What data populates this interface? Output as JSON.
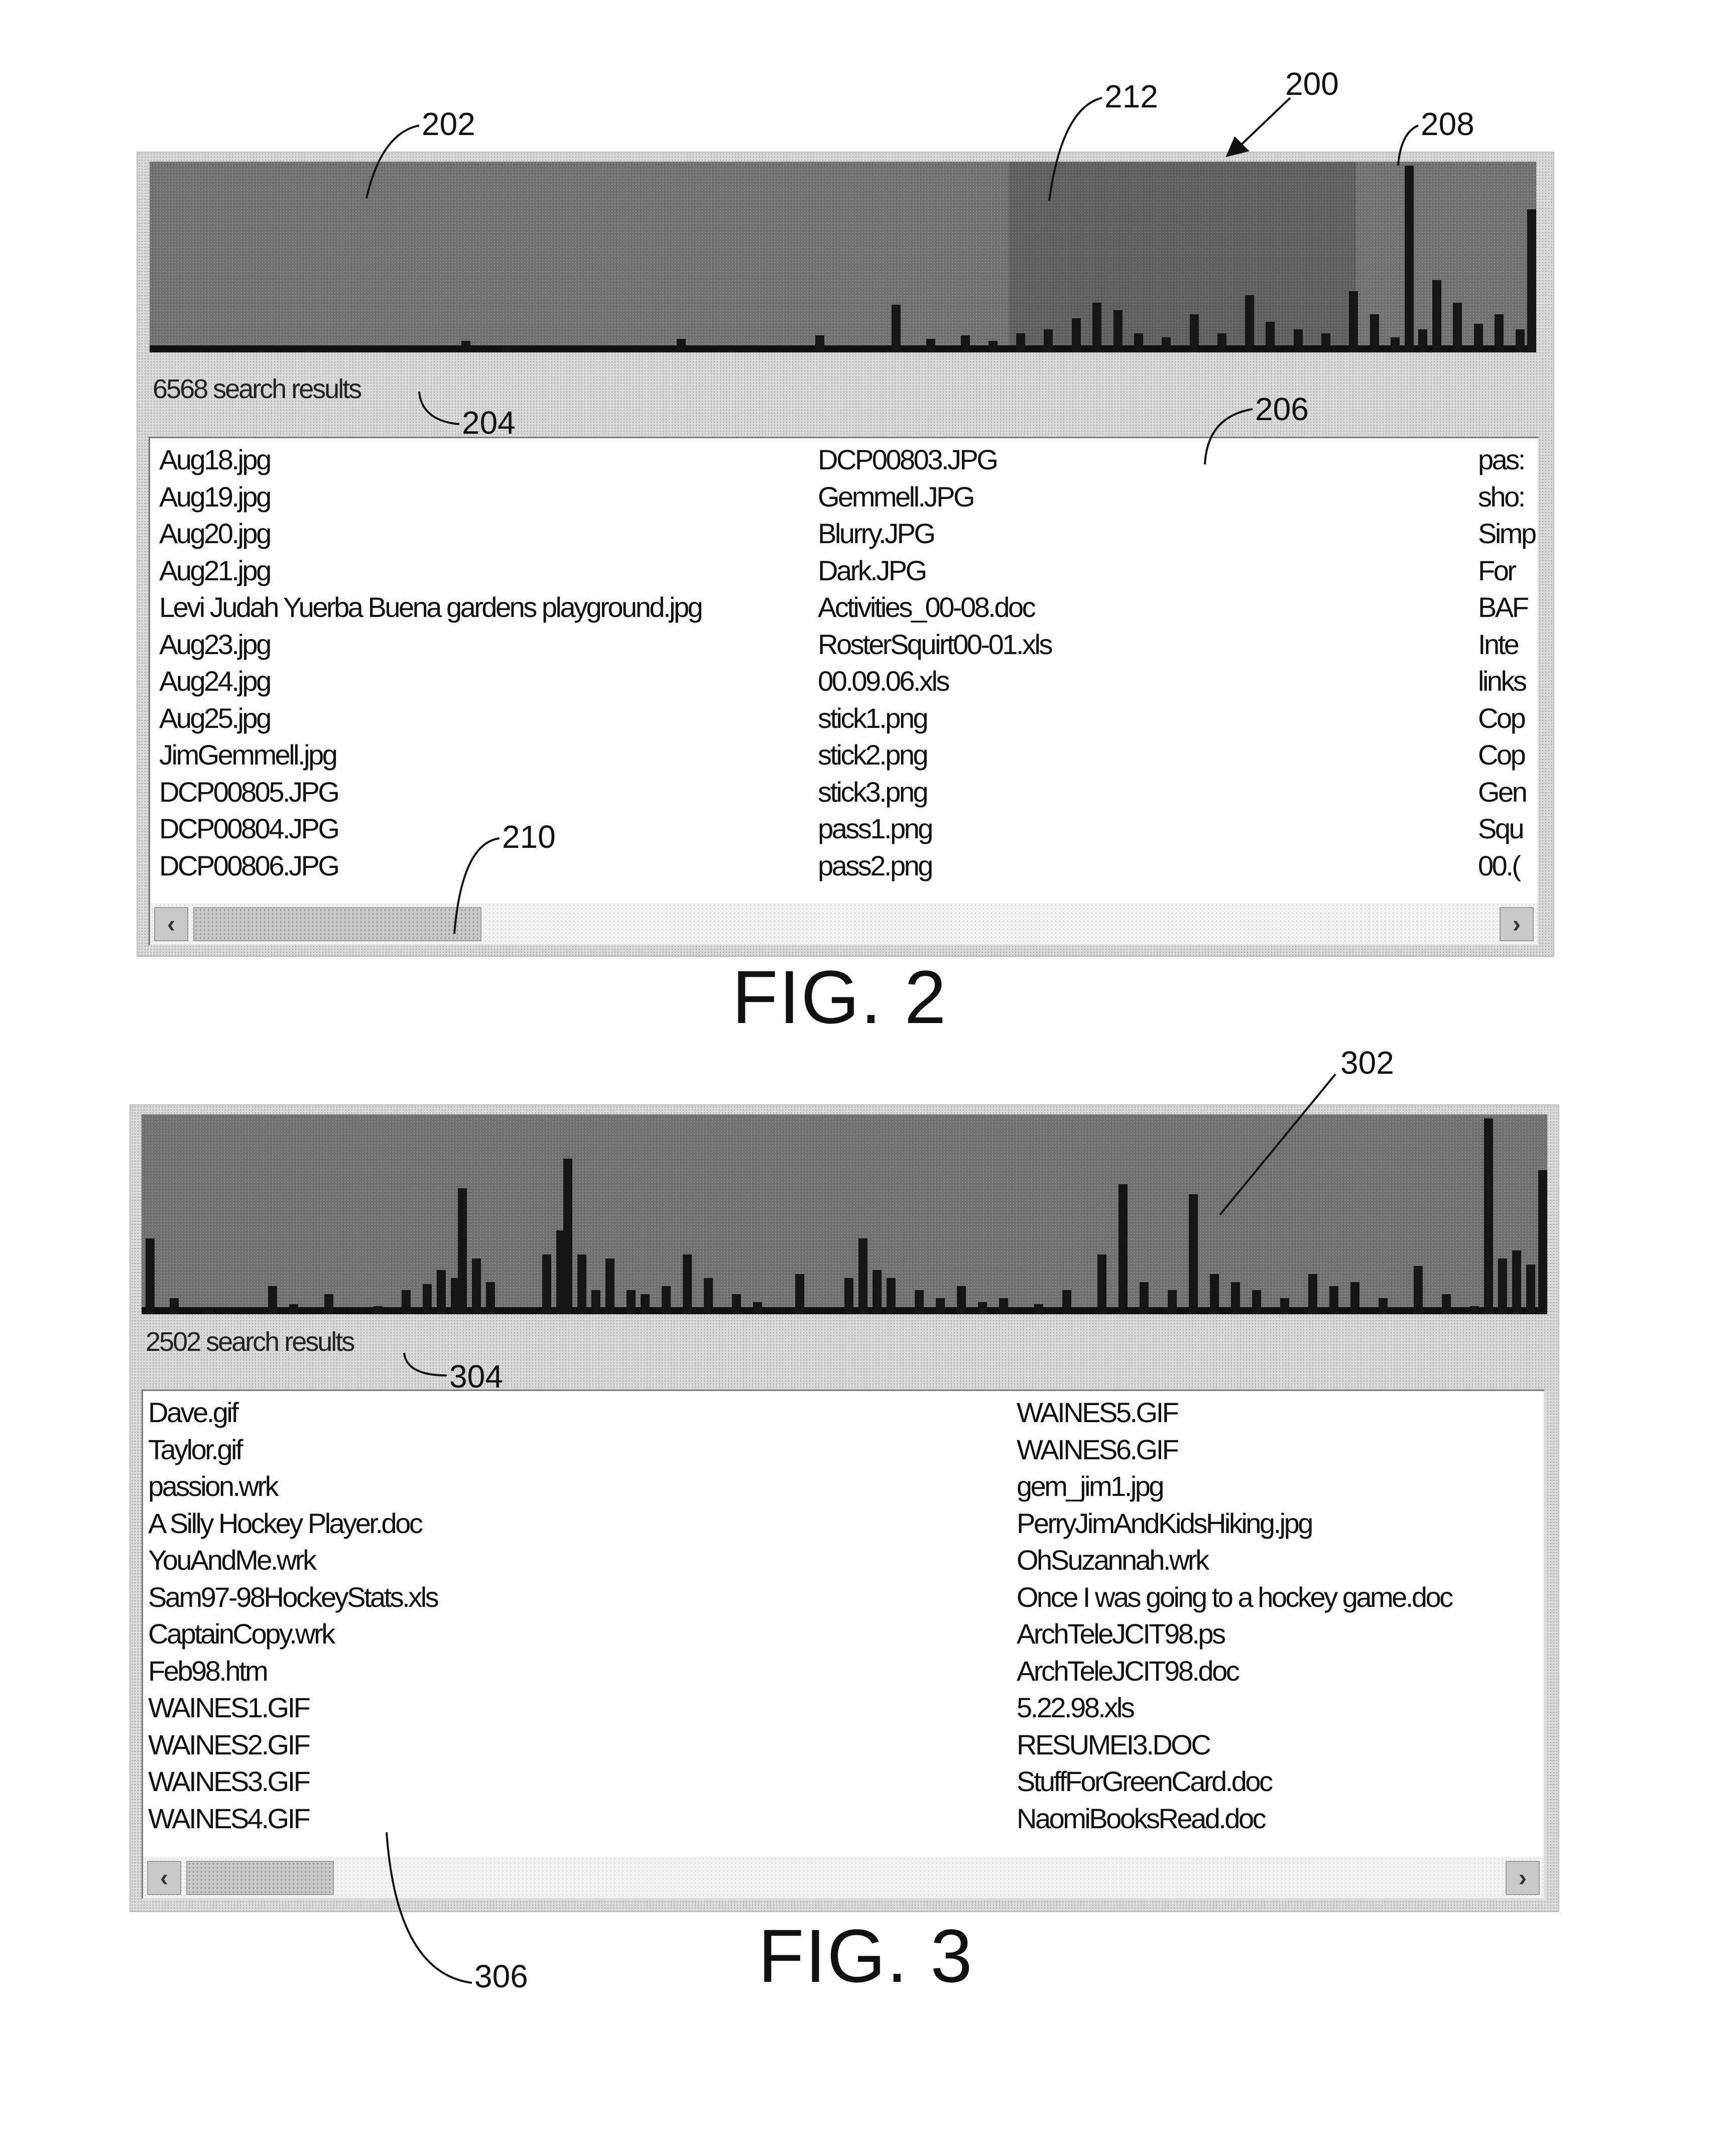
{
  "figures": [
    {
      "label": "FIG. 2",
      "result_count_text": "6568 search results",
      "reference_numerals": {
        "ui": "200",
        "histogram": "202",
        "result_count": "204",
        "result_list": "206",
        "histogram_spike": "208",
        "scrollbar": "210",
        "selected_range": "212"
      },
      "histogram": {
        "selected_range_fraction": [
          0.62,
          0.87
        ],
        "bars": [
          {
            "pos": 0.225,
            "h": 0.06
          },
          {
            "pos": 0.255,
            "h": 0.03
          },
          {
            "pos": 0.38,
            "h": 0.07
          },
          {
            "pos": 0.48,
            "h": 0.09
          },
          {
            "pos": 0.535,
            "h": 0.25
          },
          {
            "pos": 0.56,
            "h": 0.07
          },
          {
            "pos": 0.585,
            "h": 0.09
          },
          {
            "pos": 0.605,
            "h": 0.06
          },
          {
            "pos": 0.625,
            "h": 0.1
          },
          {
            "pos": 0.645,
            "h": 0.12
          },
          {
            "pos": 0.665,
            "h": 0.18
          },
          {
            "pos": 0.68,
            "h": 0.26
          },
          {
            "pos": 0.695,
            "h": 0.22
          },
          {
            "pos": 0.71,
            "h": 0.1
          },
          {
            "pos": 0.73,
            "h": 0.08
          },
          {
            "pos": 0.75,
            "h": 0.2
          },
          {
            "pos": 0.77,
            "h": 0.1
          },
          {
            "pos": 0.79,
            "h": 0.3
          },
          {
            "pos": 0.805,
            "h": 0.16
          },
          {
            "pos": 0.825,
            "h": 0.12
          },
          {
            "pos": 0.845,
            "h": 0.1
          },
          {
            "pos": 0.865,
            "h": 0.32
          },
          {
            "pos": 0.88,
            "h": 0.2
          },
          {
            "pos": 0.895,
            "h": 0.08
          },
          {
            "pos": 0.905,
            "h": 0.98
          },
          {
            "pos": 0.915,
            "h": 0.12
          },
          {
            "pos": 0.925,
            "h": 0.38
          },
          {
            "pos": 0.94,
            "h": 0.26
          },
          {
            "pos": 0.955,
            "h": 0.15
          },
          {
            "pos": 0.97,
            "h": 0.2
          },
          {
            "pos": 0.985,
            "h": 0.12
          },
          {
            "pos": 0.995,
            "h": 0.75
          }
        ]
      },
      "columns": [
        [
          "Aug18.jpg",
          "Aug19.jpg",
          "Aug20.jpg",
          "Aug21.jpg",
          "Levi Judah Yuerba Buena gardens playground.jpg",
          "Aug23.jpg",
          "Aug24.jpg",
          "Aug25.jpg",
          "JimGemmell.jpg",
          "DCP00805.JPG",
          "DCP00804.JPG",
          "DCP00806.JPG"
        ],
        [
          "DCP00803.JPG",
          "Gemmell.JPG",
          "Blurry.JPG",
          "Dark.JPG",
          "Activities_00-08.doc",
          "RosterSquirt00-01.xls",
          "00.09.06.xls",
          "stick1.png",
          "stick2.png",
          "stick3.png",
          "pass1.png",
          "pass2.png"
        ],
        [
          "pas:",
          "sho:",
          "Simp",
          "For",
          "BAF",
          "Inte",
          "links",
          "Cop",
          "Cop",
          "Gen",
          "Squ",
          "00.("
        ]
      ],
      "scrollbar": {
        "left_arrow": "‹",
        "right_arrow": "›",
        "thumb_fraction": 0.2
      }
    },
    {
      "label": "FIG. 3",
      "result_count_text": "2502 search results",
      "reference_numerals": {
        "histogram": "302",
        "result_count": "304",
        "result_list": "306"
      },
      "histogram": {
        "bars": [
          {
            "pos": 0.003,
            "h": 0.38
          },
          {
            "pos": 0.02,
            "h": 0.08
          },
          {
            "pos": 0.045,
            "h": 0.02
          },
          {
            "pos": 0.09,
            "h": 0.14
          },
          {
            "pos": 0.105,
            "h": 0.05
          },
          {
            "pos": 0.13,
            "h": 0.1
          },
          {
            "pos": 0.165,
            "h": 0.04
          },
          {
            "pos": 0.185,
            "h": 0.12
          },
          {
            "pos": 0.2,
            "h": 0.15
          },
          {
            "pos": 0.21,
            "h": 0.22
          },
          {
            "pos": 0.22,
            "h": 0.18
          },
          {
            "pos": 0.225,
            "h": 0.63
          },
          {
            "pos": 0.235,
            "h": 0.28
          },
          {
            "pos": 0.245,
            "h": 0.16
          },
          {
            "pos": 0.285,
            "h": 0.3
          },
          {
            "pos": 0.295,
            "h": 0.42
          },
          {
            "pos": 0.3,
            "h": 0.78
          },
          {
            "pos": 0.31,
            "h": 0.3
          },
          {
            "pos": 0.32,
            "h": 0.12
          },
          {
            "pos": 0.33,
            "h": 0.28
          },
          {
            "pos": 0.345,
            "h": 0.12
          },
          {
            "pos": 0.355,
            "h": 0.1
          },
          {
            "pos": 0.37,
            "h": 0.14
          },
          {
            "pos": 0.385,
            "h": 0.3
          },
          {
            "pos": 0.4,
            "h": 0.18
          },
          {
            "pos": 0.42,
            "h": 0.1
          },
          {
            "pos": 0.435,
            "h": 0.06
          },
          {
            "pos": 0.465,
            "h": 0.2
          },
          {
            "pos": 0.5,
            "h": 0.18
          },
          {
            "pos": 0.51,
            "h": 0.38
          },
          {
            "pos": 0.52,
            "h": 0.22
          },
          {
            "pos": 0.53,
            "h": 0.18
          },
          {
            "pos": 0.55,
            "h": 0.12
          },
          {
            "pos": 0.565,
            "h": 0.08
          },
          {
            "pos": 0.58,
            "h": 0.14
          },
          {
            "pos": 0.595,
            "h": 0.06
          },
          {
            "pos": 0.61,
            "h": 0.08
          },
          {
            "pos": 0.635,
            "h": 0.05
          },
          {
            "pos": 0.655,
            "h": 0.12
          },
          {
            "pos": 0.68,
            "h": 0.3
          },
          {
            "pos": 0.695,
            "h": 0.65
          },
          {
            "pos": 0.71,
            "h": 0.16
          },
          {
            "pos": 0.73,
            "h": 0.12
          },
          {
            "pos": 0.745,
            "h": 0.6
          },
          {
            "pos": 0.76,
            "h": 0.2
          },
          {
            "pos": 0.775,
            "h": 0.16
          },
          {
            "pos": 0.79,
            "h": 0.12
          },
          {
            "pos": 0.81,
            "h": 0.08
          },
          {
            "pos": 0.83,
            "h": 0.2
          },
          {
            "pos": 0.845,
            "h": 0.14
          },
          {
            "pos": 0.86,
            "h": 0.16
          },
          {
            "pos": 0.88,
            "h": 0.08
          },
          {
            "pos": 0.905,
            "h": 0.24
          },
          {
            "pos": 0.925,
            "h": 0.1
          },
          {
            "pos": 0.945,
            "h": 0.04
          },
          {
            "pos": 0.955,
            "h": 0.98
          },
          {
            "pos": 0.965,
            "h": 0.28
          },
          {
            "pos": 0.975,
            "h": 0.32
          },
          {
            "pos": 0.985,
            "h": 0.25
          },
          {
            "pos": 0.995,
            "h": 0.72
          }
        ]
      },
      "columns": [
        [
          "Dave.gif",
          "Taylor.gif",
          "passion.wrk",
          "A Silly Hockey Player.doc",
          "YouAndMe.wrk",
          "Sam97-98HockeyStats.xls",
          "CaptainCopy.wrk",
          "Feb98.htm",
          "WAINES1.GIF",
          "WAINES2.GIF",
          "WAINES3.GIF",
          "WAINES4.GIF"
        ],
        [
          "WAINES5.GIF",
          "WAINES6.GIF",
          "gem_jim1.jpg",
          "PerryJimAndKidsHiking.jpg",
          "OhSuzannah.wrk",
          "Once I was going to a hockey game.doc",
          "ArchTeleJCIT98.ps",
          "ArchTeleJCIT98.doc",
          "5.22.98.xls",
          "RESUMEI3.DOC",
          "StuffForGreenCard.doc",
          "NaomiBooksRead.doc"
        ]
      ],
      "scrollbar": {
        "left_arrow": "‹",
        "right_arrow": "›",
        "thumb_fraction": 0.1
      }
    }
  ]
}
